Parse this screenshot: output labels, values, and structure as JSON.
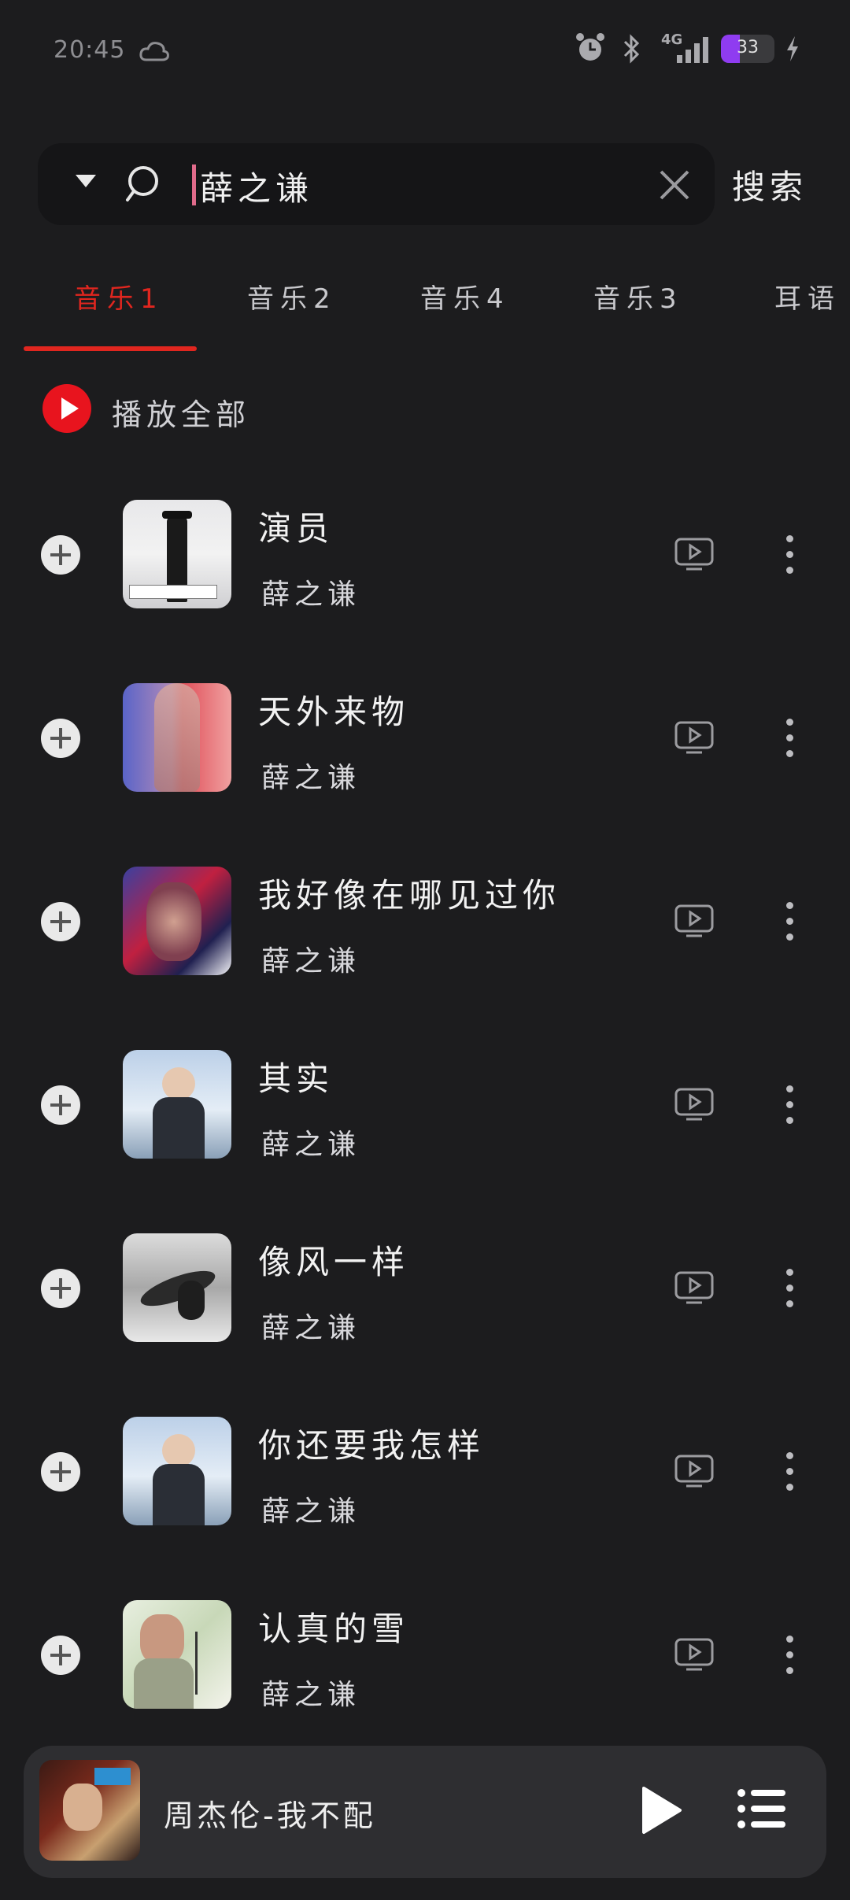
{
  "status_bar": {
    "time": "20:45",
    "network": "4G",
    "battery": "33"
  },
  "search": {
    "query": "薛之谦",
    "button_label": "搜索"
  },
  "tabs": [
    {
      "label": "音乐1",
      "active": true
    },
    {
      "label": "音乐2",
      "active": false
    },
    {
      "label": "音乐4",
      "active": false
    },
    {
      "label": "音乐3",
      "active": false
    },
    {
      "label": "耳语",
      "active": false
    }
  ],
  "play_all_label": "播放全部",
  "songs": [
    {
      "title": "演员",
      "artist": "薛之谦"
    },
    {
      "title": "天外来物",
      "artist": "薛之谦"
    },
    {
      "title": "我好像在哪见过你",
      "artist": "薛之谦"
    },
    {
      "title": "其实",
      "artist": "薛之谦"
    },
    {
      "title": "像风一样",
      "artist": "薛之谦"
    },
    {
      "title": "你还要我怎样",
      "artist": "薛之谦"
    },
    {
      "title": "认真的雪",
      "artist": "薛之谦"
    }
  ],
  "mini_player": {
    "now_playing": "周杰伦-我不配"
  },
  "colors": {
    "background": "#1c1c1e",
    "accent_red": "#e0261f",
    "play_red": "#e8141e"
  }
}
